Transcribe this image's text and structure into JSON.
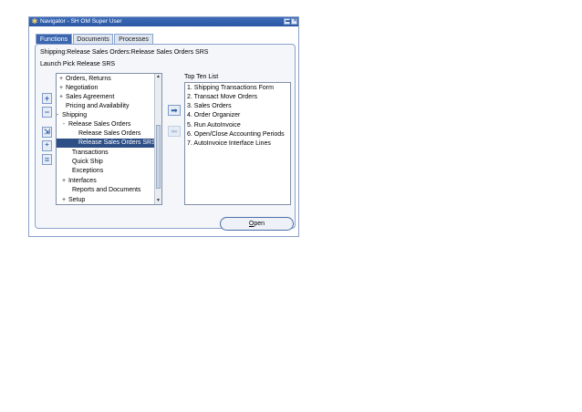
{
  "window": {
    "title": "Navigator - SH OM Super User",
    "minimize_glyph": "▬",
    "close_glyph": "✕"
  },
  "tabs": [
    {
      "label": "Functions",
      "active": true
    },
    {
      "label": "Documents",
      "active": false
    },
    {
      "label": "Processes",
      "active": false
    }
  ],
  "breadcrumb": "Shipping:Release Sales Orders:Release Sales Orders SRS",
  "launch_text": "Launch Pick Release SRS",
  "side_buttons": [
    {
      "name": "expand-button",
      "glyph": "+"
    },
    {
      "name": "collapse-button",
      "glyph": "−"
    },
    {
      "name": "expand-branch-button",
      "glyph": "⇲"
    },
    {
      "name": "expand-all-button",
      "glyph": "⁺"
    },
    {
      "name": "collapse-all-button",
      "glyph": "≡"
    }
  ],
  "tree": {
    "items": [
      {
        "label": "Orders, Returns",
        "marker": "+"
      },
      {
        "label": "Negotiation",
        "marker": "+"
      },
      {
        "label": "Sales Agreement",
        "marker": "+"
      },
      {
        "label": "Pricing and Availability",
        "marker": ""
      },
      {
        "label": "Shipping",
        "marker": "-"
      },
      {
        "label": "Release Sales Orders",
        "marker": "-"
      },
      {
        "label": "Release Sales Orders",
        "marker": ""
      },
      {
        "label": "Release Sales Orders SRS",
        "marker": "",
        "selected": true
      },
      {
        "label": "Transactions",
        "marker": ""
      },
      {
        "label": "Quick Ship",
        "marker": ""
      },
      {
        "label": "Exceptions",
        "marker": ""
      },
      {
        "label": "Interfaces",
        "marker": "+"
      },
      {
        "label": "Reports and Documents",
        "marker": ""
      },
      {
        "label": "Setup",
        "marker": "+"
      }
    ],
    "scroll_up": "▲",
    "scroll_down": "▼"
  },
  "transfer": {
    "add_glyph": "➡",
    "remove_glyph": "⬅"
  },
  "top_ten": {
    "label": "Top Ten List",
    "items": [
      "1. Shipping Transactions Form",
      "2. Transact Move Orders",
      "3. Sales Orders",
      "4. Order Organizer",
      "5. Run AutoInvoice",
      "6. Open/Close Accounting Periods",
      "7. AutoInvoice Interface Lines"
    ]
  },
  "open_button": {
    "mnemonic": "O",
    "rest": "pen"
  },
  "colors": {
    "titlebar": "#2a56a2",
    "selection": "#2d4f86",
    "active_tab": "#3a66b0"
  }
}
